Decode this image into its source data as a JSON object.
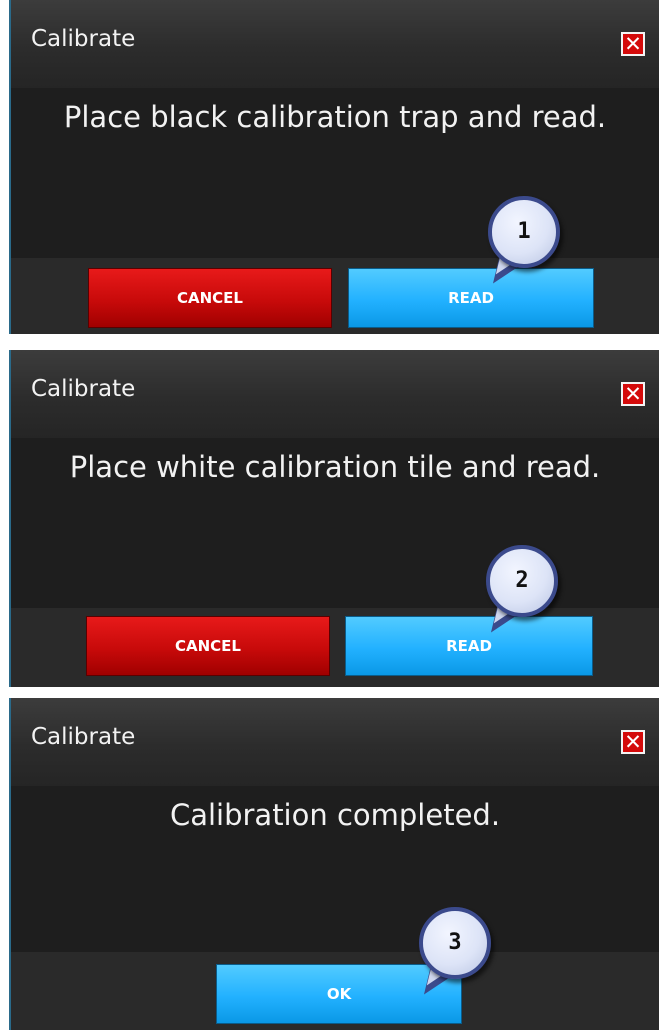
{
  "dialogs": [
    {
      "title": "Calibrate",
      "close_glyph": "✕",
      "message": "Place black calibration trap and read.",
      "cancel_label": "CANCEL",
      "read_label": "READ",
      "callout": "1"
    },
    {
      "title": "Calibrate",
      "close_glyph": "✕",
      "message": "Place white calibration tile and read.",
      "cancel_label": "CANCEL",
      "read_label": "READ",
      "callout": "2"
    },
    {
      "title": "Calibrate",
      "close_glyph": "✕",
      "message": "Calibration completed.",
      "ok_label": "OK",
      "callout": "3"
    }
  ],
  "icons": {
    "close": "close-icon",
    "callout": "step-callout-icon"
  },
  "colors": {
    "dialog_bg": "#1e1e1e",
    "cancel_button": "#d40a0a",
    "read_button": "#22b1ff",
    "close_icon": "#d40a0a",
    "callout_border": "#3b4a8c"
  }
}
